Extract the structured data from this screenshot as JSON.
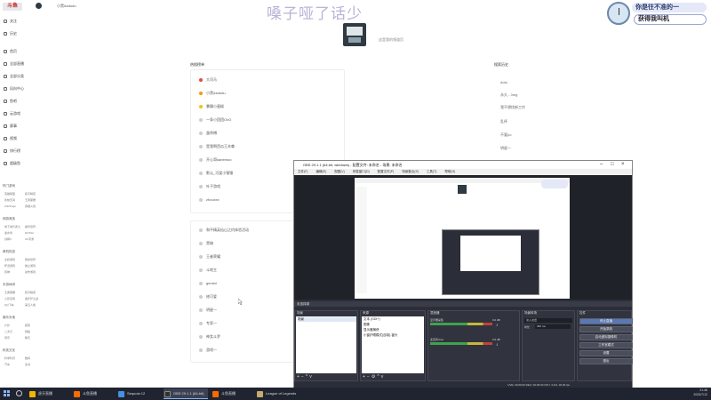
{
  "topbar": {
    "logo_text": "斗鱼",
    "page_name": "小黑&sdudu",
    "watermark": "嗓子哑了话少",
    "badge_line1": "你是往不准的一",
    "badge_line2": "获得我叫机"
  },
  "sidebar": {
    "items": [
      {
        "label": "关注",
        "icon": "heart-icon"
      },
      {
        "label": "历史",
        "icon": "clock-icon"
      },
      {
        "label": "首页",
        "icon": "home-icon"
      },
      {
        "label": "全部直播",
        "icon": "grid-icon"
      },
      {
        "label": "全部分类",
        "icon": "category-icon"
      },
      {
        "label": "风向中心",
        "icon": "compass-icon"
      },
      {
        "label": "鱼吧",
        "icon": "fish-icon"
      },
      {
        "label": "云游戏",
        "icon": "cloud-icon"
      },
      {
        "label": "赛事",
        "icon": "trophy-icon"
      },
      {
        "label": "视频",
        "icon": "video-icon"
      },
      {
        "label": "排行榜",
        "icon": "rank-icon"
      },
      {
        "label": "超级鱼",
        "icon": "crown-icon"
      }
    ],
    "sections": [
      {
        "title": "热门游戏",
        "subs": [
          "英雄联盟",
          "和平精英",
          "永劫无间",
          "王者荣耀",
          "CS2/csgo",
          "穿越火线"
        ]
      },
      {
        "title": "网游竞技",
        "subs": [
          "地下城与勇士",
          "魔兽世界",
          "逆水寒",
          "DOTA2",
          "剑网3",
          "CF手游"
        ]
      },
      {
        "title": "单机热游",
        "subs": [
          "主机游戏",
          "我的世界",
          "怀旧游戏",
          "独立游戏",
          "原神",
          "动作游戏"
        ]
      },
      {
        "title": "手游休闲",
        "subs": [
          "王者荣耀",
          "和平精英",
          "火影忍者",
          "金铲铲之战",
          "QQ飞车",
          "第五人格"
        ]
      },
      {
        "title": "娱乐天地",
        "subs": [
          "户外",
          "颜值",
          "二次元",
          "舞蹈",
          "音乐",
          "聊天"
        ]
      },
      {
        "title": "科技文化",
        "subs": [
          "科学科普",
          "数码",
          "汽车",
          "读书"
        ]
      }
    ]
  },
  "channel": {
    "description": "这是我的频道页"
  },
  "hot_search": {
    "title": "热搜榜单",
    "items": [
      "大司马",
      "小黑&sdudu",
      "暴躁小蛋糕",
      "一条小团团OvO",
      "蛋师傅",
      "是我啊西瓜王本尊",
      "开心哥kanemoo",
      "默认_可爱小锤锤",
      "叶子游戏",
      "zhouxxx"
    ]
  },
  "recommend": {
    "items": [
      "和平精英仙山之约体验活动",
      "黑暗",
      "王者荣耀",
      "斗地主",
      "gemini",
      "修可爱",
      "明星一",
      "专家一",
      "神女斗罗",
      "游戏一"
    ]
  },
  "search_history": {
    "title": "搜索历史",
    "items": [
      "dota",
      "永久 - 3mg",
      "我不想找新工作",
      "乱杯",
      "不要po",
      "明星一"
    ]
  },
  "obs": {
    "title": "OBS 29.1.1 (64-bit, windows) - 配置文件: 未命名 - 场景: 未命名",
    "menu": [
      "文件(F)",
      "编辑(E)",
      "视图(V)",
      "停靠窗口(D)",
      "配置文件(P)",
      "场景集合(S)",
      "工具(T)",
      "帮助(H)"
    ],
    "dock_bar": "未选择源",
    "docks": {
      "scenes": {
        "title": "场景",
        "items": [
          "场景"
        ]
      },
      "sources": {
        "title": "来源",
        "items": [
          "文本 (GDI+)",
          "图像",
          "显示器捕获",
          "小窗护眼模式(自制)-窗头"
        ]
      },
      "mixer": {
        "title": "混音器",
        "channels": [
          {
            "label": "显示器采集",
            "db": "0.0 dB"
          },
          {
            "label": "麦克风/Aux",
            "db": "0.0 dB"
          }
        ]
      },
      "transitions": {
        "title": "场景转场",
        "value": "淡入淡出",
        "duration_label": "时长",
        "duration": "300 ms"
      },
      "controls": {
        "title": "控件",
        "buttons": [
          "停止直播",
          "开始录制",
          "启动虚拟摄像机",
          "工作室模式",
          "设置",
          "退出"
        ]
      }
    },
    "status": "LIVE: 00:00:00   REC: 00:00:00   CPU: 3.4%, 30.00 fps"
  },
  "taskbar": {
    "apps": [
      {
        "label": "虎牙直播",
        "color": "#f4b400"
      },
      {
        "label": "斗鱼直播",
        "color": "#ff6a00"
      },
      {
        "label": "Sequoia 12",
        "color": "#4a90e2"
      },
      {
        "label": "OBS 29.1.1 (64-bit)",
        "color": "#303030"
      },
      {
        "label": "斗鱼直播",
        "color": "#ff6a00"
      },
      {
        "label": "League of Legends",
        "color": "#c8aa6e"
      }
    ],
    "time": "21:46",
    "date": "2023/7/12"
  }
}
